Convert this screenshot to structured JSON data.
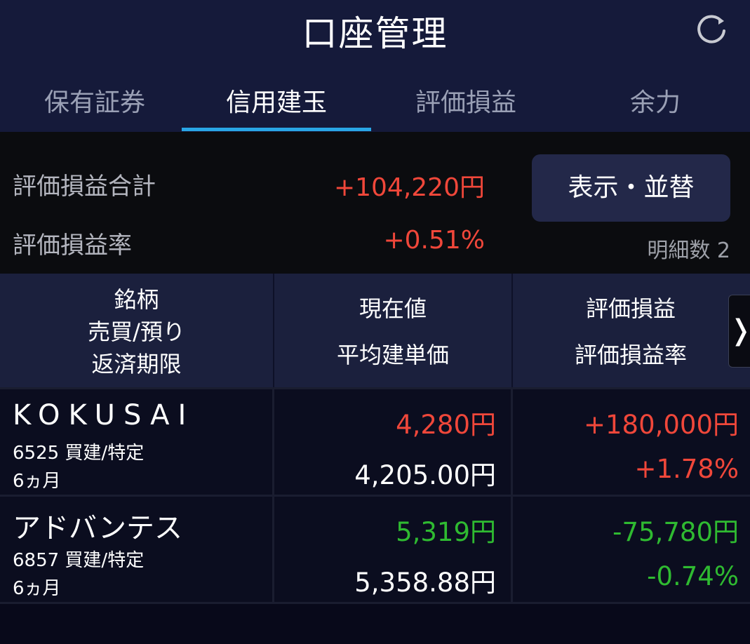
{
  "header": {
    "title": "口座管理",
    "refresh_icon": "refresh-icon"
  },
  "tabs": [
    {
      "label": "保有証券",
      "active": false
    },
    {
      "label": "信用建玉",
      "active": true
    },
    {
      "label": "評価損益",
      "active": false
    },
    {
      "label": "余力",
      "active": false
    }
  ],
  "summary": {
    "total_label": "評価損益合計",
    "total_value": "+104,220円",
    "rate_label": "評価損益率",
    "rate_value": "+0.51%",
    "sort_button": "表示・並替",
    "detail_count": "明細数 2"
  },
  "table": {
    "headers": {
      "col1": [
        "銘柄",
        "売買/預り",
        "返済期限"
      ],
      "col2": [
        "現在値",
        "平均建単価"
      ],
      "col3": [
        "評価損益",
        "評価損益率"
      ]
    },
    "scroll_icon": "chevron-right-icon",
    "rows": [
      {
        "name": "KOKUSAI",
        "code_trade": "6525 買建/特定",
        "deadline": "6ヵ月",
        "current_price": "4,280円",
        "avg_price": "4,205.00円",
        "pl": "+180,000円",
        "pl_rate": "+1.78%"
      },
      {
        "name": "アドバンテス",
        "code_trade": "6857 買建/特定",
        "deadline": "6ヵ月",
        "current_price": "5,319円",
        "avg_price": "5,358.88円",
        "pl": "-75,780円",
        "pl_rate": "-0.74%"
      }
    ]
  },
  "colors": {
    "positive": "#f0473a",
    "negative": "#2fba31",
    "accent": "#29a6e6"
  }
}
